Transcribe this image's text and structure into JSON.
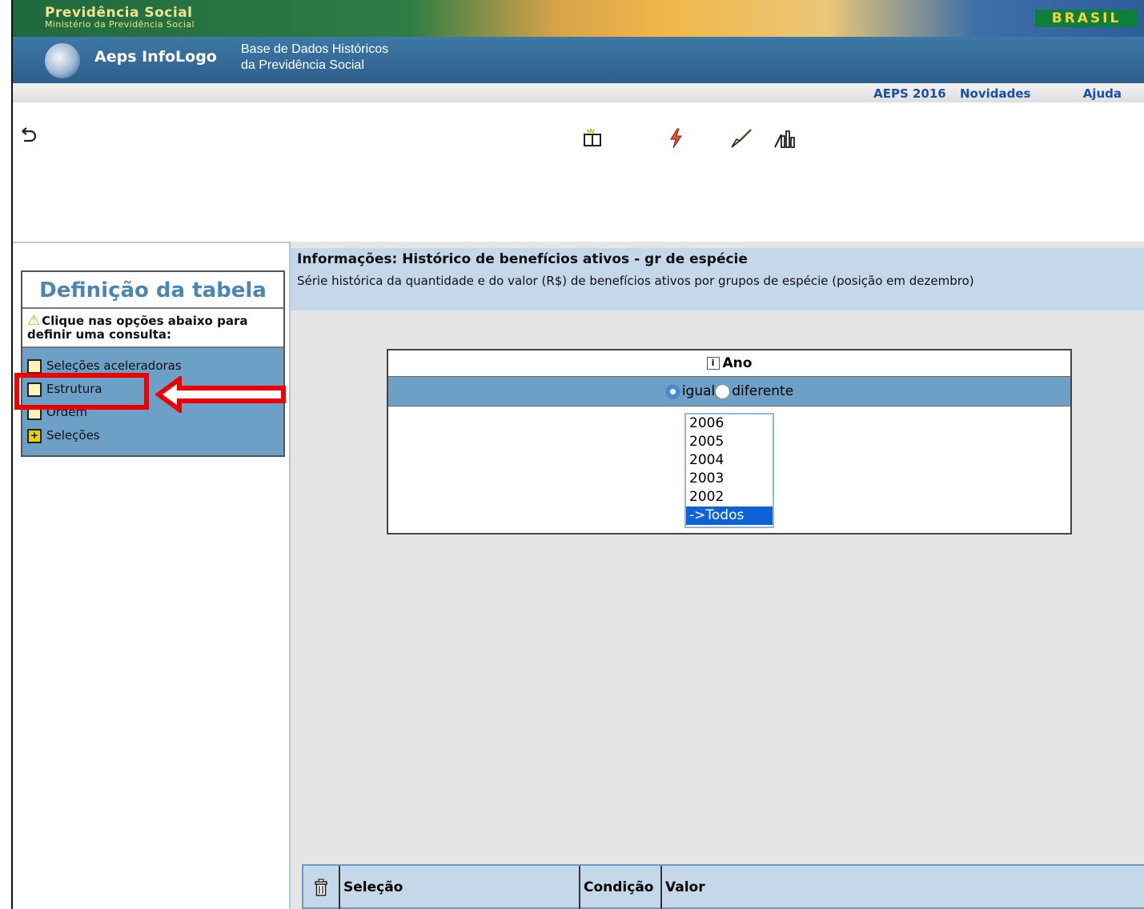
{
  "banner": {
    "org_title": "Previdência Social",
    "org_subtitle": "Ministério da Previdência Social",
    "country_logo": "BRASIL"
  },
  "app": {
    "name": "Aeps InfoLogo",
    "subtitle_line1": "Base de Dados Históricos",
    "subtitle_line2": "da Previdência Social"
  },
  "nav": {
    "links": [
      "AEPS 2016",
      "Novidades"
    ],
    "help": "Ajuda"
  },
  "toolbar": {
    "icons": [
      "back-icon",
      "new-table-icon",
      "lightning-icon",
      "clear-broom-icon",
      "chart-icon"
    ]
  },
  "sidebar": {
    "title": "Definição da tabela",
    "hint": "Clique nas opções abaixo para definir uma consulta:",
    "items": [
      {
        "label": "Seleções aceleradoras"
      },
      {
        "label": "Estrutura"
      },
      {
        "label": "Ordem"
      },
      {
        "label": "Seleções"
      }
    ]
  },
  "info": {
    "title": "Informações: Histórico de benefícios ativos - gr de espécie",
    "description": "Série histórica da quantidade e do valor (R$) de benefícios ativos por grupos de espécie (posição em dezembro)"
  },
  "filter": {
    "field": "Ano",
    "radio_equal": "igual",
    "radio_different": "diferente",
    "options": [
      "2006",
      "2005",
      "2004",
      "2003",
      "2002",
      "->Todos"
    ],
    "selected": "->Todos"
  },
  "selection_table": {
    "columns": [
      "Seleção",
      "Condição",
      "Valor"
    ]
  },
  "colors": {
    "accent_blue": "#6da0c7",
    "title_blue": "#4a86b5",
    "annotation_red": "#ee0000"
  }
}
